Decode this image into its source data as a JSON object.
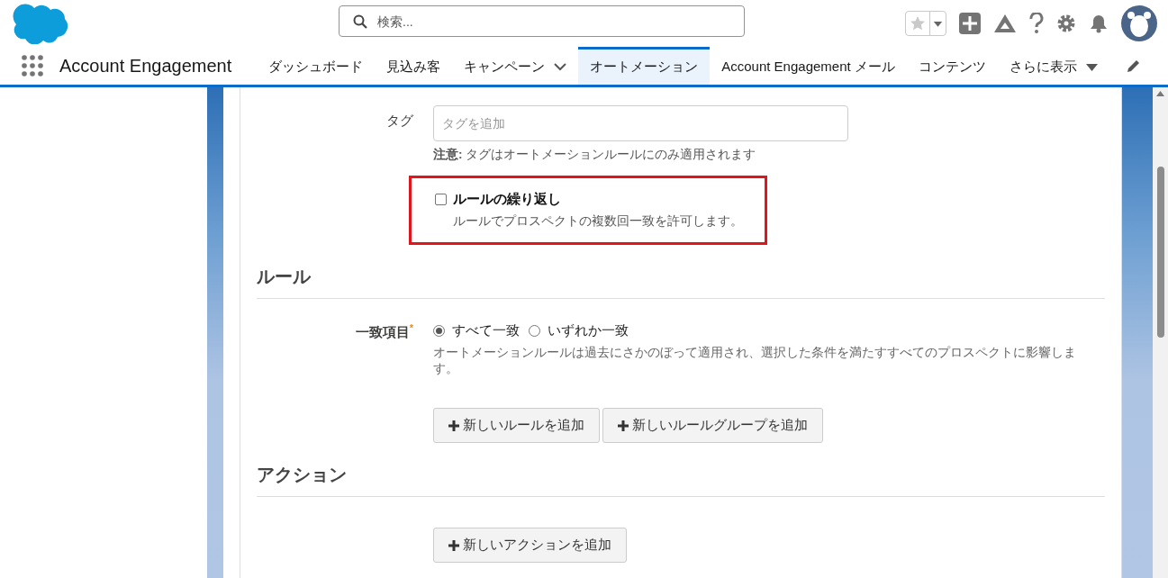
{
  "header": {
    "search": {
      "placeholder": "検索..."
    }
  },
  "nav": {
    "app_name": "Account Engagement",
    "tabs": [
      {
        "label": "ダッシュボード",
        "kind": "link",
        "selected": false
      },
      {
        "label": "見込み客",
        "kind": "link",
        "selected": false
      },
      {
        "label": "キャンペーン",
        "kind": "dropdown",
        "selected": false
      },
      {
        "label": "オートメーション",
        "kind": "link",
        "selected": true
      },
      {
        "label": "Account Engagement メール",
        "kind": "link",
        "selected": false
      },
      {
        "label": "コンテンツ",
        "kind": "link",
        "selected": false
      },
      {
        "label": "さらに表示",
        "kind": "more",
        "selected": false
      }
    ]
  },
  "form": {
    "tag": {
      "label": "タグ",
      "placeholder": "タグを追加",
      "note": "**注意:** タグはオートメーションルールにのみ適用されます"
    },
    "repeat": {
      "label": "ルールの繰り返し",
      "checked": false,
      "description": "ルールでプロスペクトの複数回一致を許可します。"
    }
  },
  "rules": {
    "title": "ルール",
    "match": {
      "label": "一致項目",
      "required_mark": "*",
      "options": [
        {
          "label": "すべて一致",
          "selected": true
        },
        {
          "label": "いずれか一致",
          "selected": false
        }
      ],
      "help": "オートメーションルールは過去にさかのぼって適用され、選択した条件を満たすすべてのプロスペクトに影響します。"
    },
    "buttons": [
      "新しいルールを追加",
      "新しいルールグループを追加"
    ]
  },
  "actions": {
    "title": "アクション",
    "buttons": [
      "新しいアクションを追加"
    ]
  }
}
